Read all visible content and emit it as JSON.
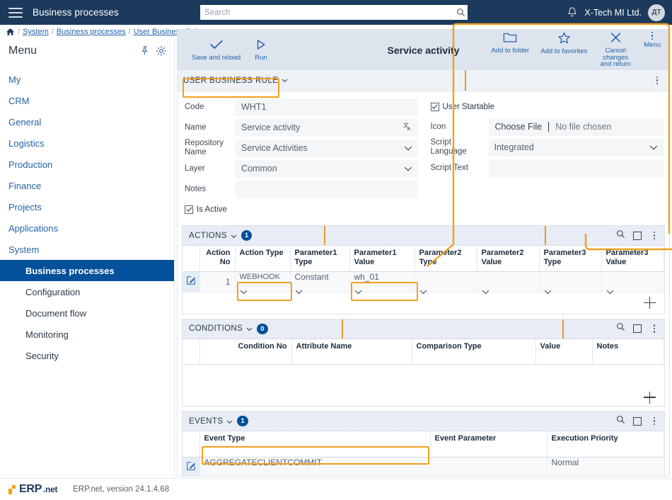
{
  "topbar": {
    "app_title": "Business processes",
    "menu_icon": "hamburger-icon",
    "search": {
      "placeholder": "Search",
      "value": "",
      "icon": "search-icon"
    },
    "notifications_icon": "bell-icon",
    "org_name": "X-Tech MI Ltd.",
    "avatar_initials": "ДТ"
  },
  "breadcrumb": {
    "home_icon": "home-icon",
    "items": [
      "System",
      "Business processes",
      "User Business Rules"
    ],
    "separator": "/"
  },
  "sidebar": {
    "title": "Menu",
    "pin_icon": "pin-icon",
    "settings_icon": "gear-icon",
    "items": [
      {
        "label": "My",
        "active": false,
        "sub": false
      },
      {
        "label": "CRM",
        "active": false,
        "sub": false
      },
      {
        "label": "General",
        "active": false,
        "sub": false
      },
      {
        "label": "Logistics",
        "active": false,
        "sub": false
      },
      {
        "label": "Production",
        "active": false,
        "sub": false
      },
      {
        "label": "Finance",
        "active": false,
        "sub": false
      },
      {
        "label": "Projects",
        "active": false,
        "sub": false
      },
      {
        "label": "Applications",
        "active": false,
        "sub": false
      },
      {
        "label": "System",
        "active": false,
        "sub": false
      },
      {
        "label": "Business processes",
        "active": true,
        "sub": true
      },
      {
        "label": "Configuration",
        "active": false,
        "sub": true
      },
      {
        "label": "Document flow",
        "active": false,
        "sub": true
      },
      {
        "label": "Monitoring",
        "active": false,
        "sub": true
      },
      {
        "label": "Security",
        "active": false,
        "sub": true
      }
    ]
  },
  "toolbar": {
    "title": "Service activity",
    "left_buttons": [
      {
        "label": "Save and reload",
        "icon": "check-icon"
      },
      {
        "label": "Run",
        "icon": "play-icon"
      }
    ],
    "right_buttons": [
      {
        "label": "Add to folder",
        "icon": "folder-icon"
      },
      {
        "label": "Add to favorites",
        "icon": "star-icon"
      },
      {
        "label": "Cancel changes and return",
        "icon": "close-icon"
      },
      {
        "label": "Menu",
        "icon": "kebab-icon"
      }
    ]
  },
  "tabstrip": {
    "tab_label": "USER BUSINESS RULE",
    "chevron": "chevron-down-icon",
    "kebab": "kebab-icon"
  },
  "form": {
    "left": [
      {
        "label": "Code",
        "value": "WHT1",
        "type": "text"
      },
      {
        "label": "Name",
        "value": "Service activity",
        "type": "text-translate"
      },
      {
        "label": "Repository Name",
        "value": "Service Activities",
        "type": "select"
      },
      {
        "label": "Layer",
        "value": "Common",
        "type": "select"
      },
      {
        "label": "Notes",
        "value": "",
        "type": "text"
      }
    ],
    "left_checkbox": {
      "label": "Is Active",
      "checked": true
    },
    "right_checkbox": {
      "label": "User Startable",
      "checked": true
    },
    "right": [
      {
        "label": "Icon",
        "type": "file",
        "button_label": "Choose File",
        "value": "No file chosen"
      },
      {
        "label": "Script Language",
        "value": "Integrated",
        "type": "select"
      },
      {
        "label": "Script Text",
        "value": "",
        "type": "text"
      }
    ]
  },
  "sections": [
    {
      "title": "ACTIONS",
      "count": "1",
      "columns": [
        "",
        "Action No",
        "Action Type",
        "Parameter1 Type",
        "Parameter1 Value",
        "Parameter2 Type",
        "Parameter2 Value",
        "Parameter3 Type",
        "Parameter3 Value"
      ],
      "rows": [
        {
          "edit_icon": "edit-row-icon",
          "action_no": "1",
          "action_type": "WEBHOOK",
          "p1_type": "Constant",
          "p1_value": "wh_01",
          "p2_type": "",
          "p2_value": "",
          "p3_type": "",
          "p3_value": ""
        }
      ],
      "tools": [
        "search-icon",
        "maximize-icon",
        "kebab-icon"
      ],
      "add_icon": "plus-icon"
    },
    {
      "title": "CONDITIONS",
      "count": "0",
      "columns": [
        "",
        "Condition No",
        "Attribute Name",
        "Comparison Type",
        "Value",
        "Notes"
      ],
      "rows": [],
      "tools": [
        "search-icon",
        "maximize-icon",
        "kebab-icon"
      ],
      "add_icon": "plus-icon"
    },
    {
      "title": "EVENTS",
      "count": "1",
      "columns": [
        "",
        "Event Type",
        "Event Parameter",
        "Execution Priority"
      ],
      "rows": [
        {
          "edit_icon": "edit-row-icon",
          "event_type": "AGGREGATECLIENTCOMMIT",
          "event_parameter": "",
          "execution_priority": "Normal"
        }
      ],
      "tools": [
        "search-icon",
        "maximize-icon",
        "kebab-icon"
      ],
      "add_icon": "plus-icon"
    }
  ],
  "footer": {
    "logo_text": "ERP",
    "logo_suffix": ".net",
    "version": "ERP.net, version 24.1.4.68"
  },
  "colors": {
    "topbar_bg": "#1c3a5c",
    "accent_blue": "#03509b",
    "link_blue": "#2563a8",
    "highlight_orange": "#f0a020",
    "panel_bg": "#e8ecf4"
  }
}
